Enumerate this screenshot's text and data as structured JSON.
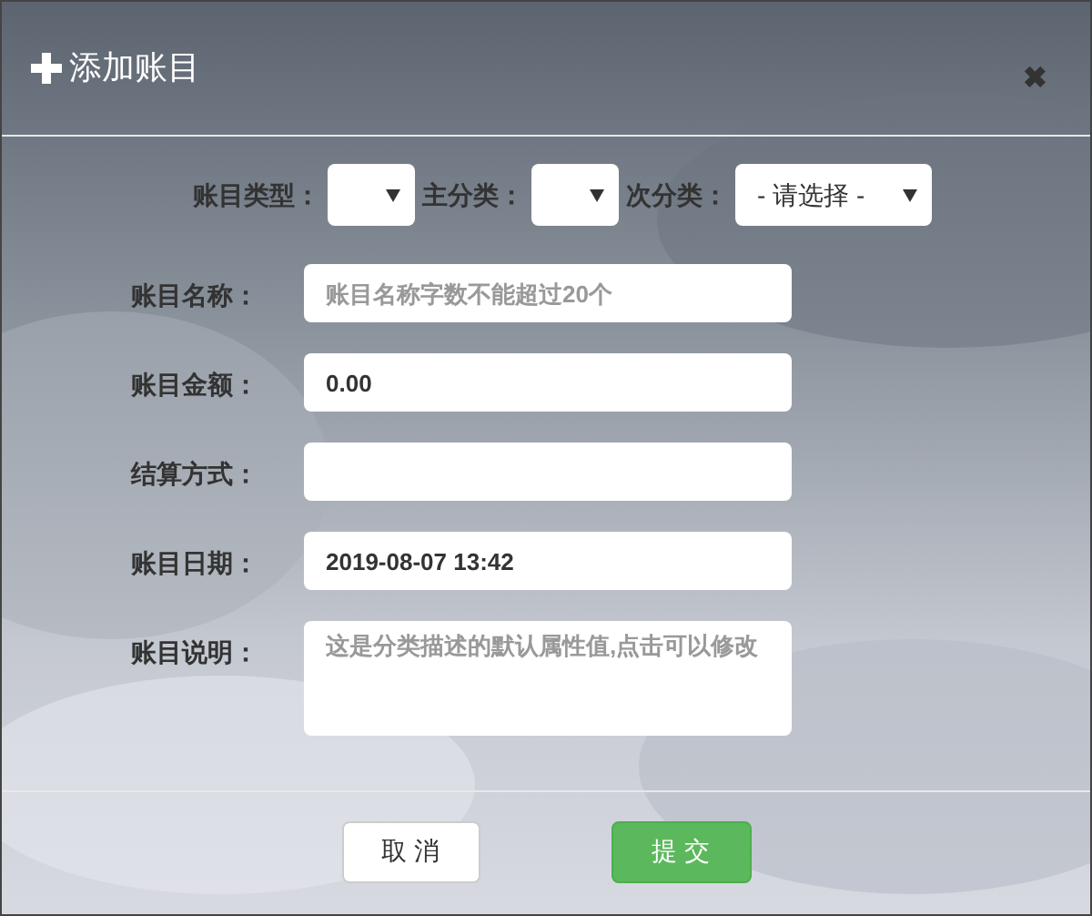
{
  "dialog": {
    "title": "添加账目",
    "close": "✖"
  },
  "selects": [
    {
      "label": "账目类型："
    },
    {
      "label": "主分类："
    },
    {
      "label": "次分类：",
      "value": "- 请选择 -"
    }
  ],
  "fields": [
    {
      "kind": "input",
      "label": "账目名称：",
      "placeholder": "账目名称字数不能超过20个"
    },
    {
      "kind": "input",
      "label": "账目金额：",
      "value": "0.00"
    },
    {
      "kind": "input",
      "label": "结算方式："
    },
    {
      "kind": "input",
      "label": "账目日期：",
      "value": "2019-08-07 13:42"
    },
    {
      "kind": "textarea",
      "label": "账目说明：",
      "placeholder": "这是分类描述的默认属性值,点击可以修改"
    }
  ],
  "buttons": [
    {
      "label": "取 消",
      "kind": "cancel"
    },
    {
      "label": "提 交",
      "kind": "submit"
    }
  ]
}
